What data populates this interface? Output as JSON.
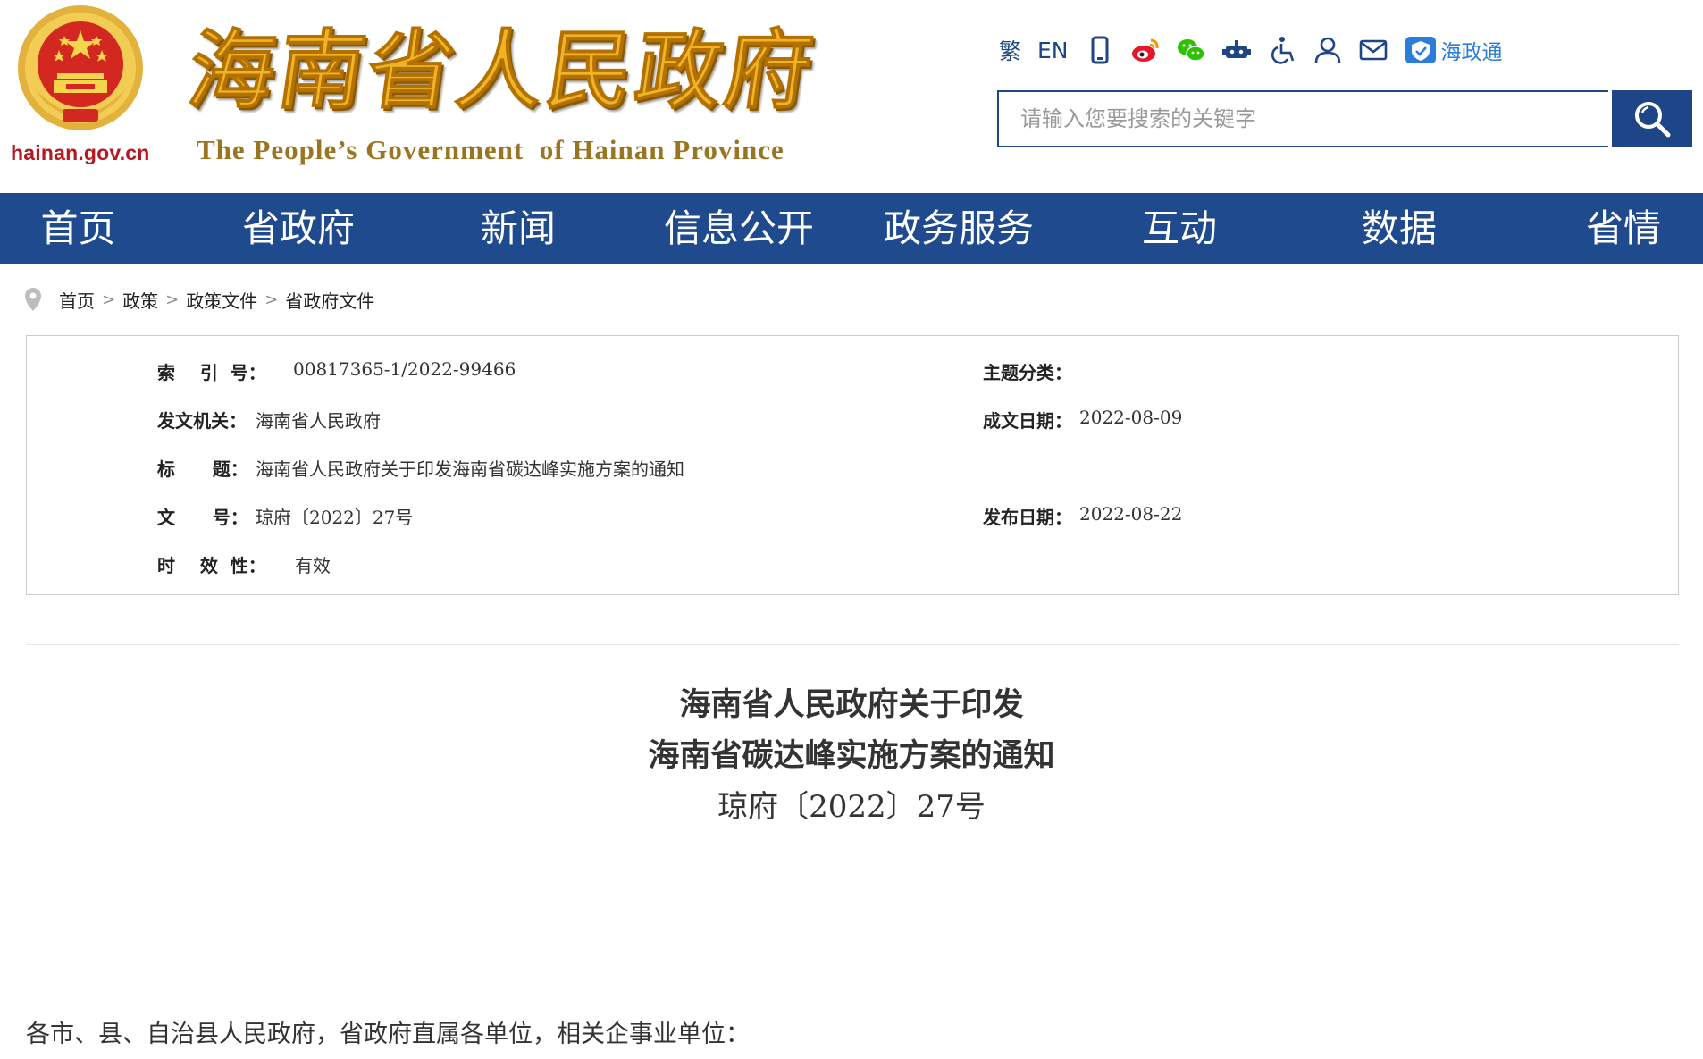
{
  "header": {
    "emblem_caption": "hainan.gov.cn",
    "site_title": "海南省人民政府",
    "site_subtitle": "The People’s Government  of Hainan Province",
    "tools": {
      "traditional": "繁",
      "english": "EN",
      "app_label": "海政通",
      "icons": [
        "mobile-icon",
        "weibo-icon",
        "wechat-icon",
        "robot-icon",
        "accessibility-icon",
        "user-icon",
        "mail-icon",
        "haizhengtong-icon"
      ]
    },
    "search": {
      "placeholder": "请输入您要搜索的关键字"
    }
  },
  "nav": {
    "items": [
      "首页",
      "省政府",
      "新闻",
      "信息公开",
      "政务服务",
      "互动",
      "数据",
      "省情"
    ]
  },
  "breadcrumb": {
    "items": [
      "首页",
      "政策",
      "政策文件",
      "省政府文件"
    ]
  },
  "info": {
    "index_label": "索    引  号：",
    "index_value": "00817365-1/2022-99466",
    "topic_label": "主题分类：",
    "topic_value": "",
    "issuer_label": "发文机关：",
    "issuer_value": "海南省人民政府",
    "date_written_label": "成文日期：",
    "date_written_value": "2022-08-09",
    "title_label": "标      题：",
    "title_value": "海南省人民政府关于印发海南省碳达峰实施方案的通知",
    "doc_no_label": "文      号：",
    "doc_no_value": "琼府〔2022〕27号",
    "publish_date_label": "发布日期：",
    "publish_date_value": "2022-08-22",
    "validity_label": "时    效  性：",
    "validity_value": "有效"
  },
  "document": {
    "title_line1": "海南省人民政府关于印发",
    "title_line2": "海南省碳达峰实施方案的通知",
    "doc_number": "琼府〔2022〕27号",
    "greeting": "各市、县、自治县人民政府，省政府直属各单位，相关企事业单位："
  },
  "colors": {
    "brand_blue": "#1f4b8e",
    "title_gold": "#efb426",
    "emblem_red": "#d21f1f"
  }
}
